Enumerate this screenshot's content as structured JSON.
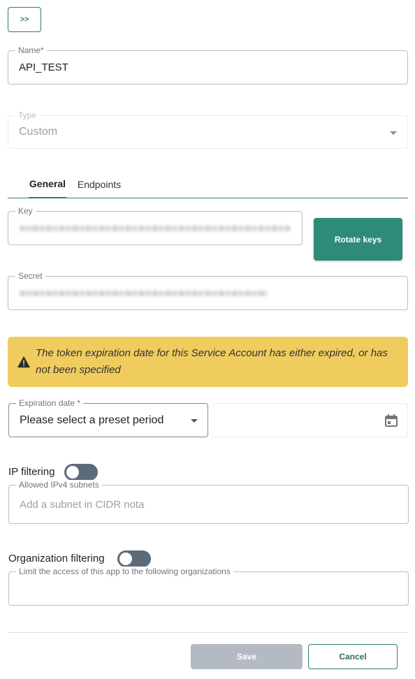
{
  "toolbar": {
    "expand_label": ">>"
  },
  "name": {
    "label": "Name*",
    "value": "API_TEST"
  },
  "type": {
    "label": "Type",
    "value": "Custom"
  },
  "tabs": [
    {
      "label": "General",
      "active": true
    },
    {
      "label": "Endpoints",
      "active": false
    }
  ],
  "key": {
    "label": "Key"
  },
  "rotate": {
    "label": "Rotate keys"
  },
  "secret": {
    "label": "Secret"
  },
  "warning": {
    "icon": "warning-triangle-icon",
    "text": "The token expiration date for this Service Account has either expired, or has not been specified"
  },
  "expiration": {
    "label": "Expiration date *",
    "selected": "Please select a preset period",
    "date_icon": "calendar-icon"
  },
  "ip_filtering": {
    "label": "IP filtering",
    "enabled": false,
    "subnets_label": "Allowed IPv4 subnets",
    "subnets_placeholder": "Add a subnet in CIDR nota"
  },
  "org_filtering": {
    "label": "Organization filtering",
    "enabled": false,
    "orgs_label": "Limit the access of this app to the following organizations"
  },
  "footer": {
    "save_label": "Save",
    "cancel_label": "Cancel"
  },
  "colors": {
    "accent": "#2e8b7a",
    "warning_bg": "#f0cc5f",
    "toggle_off": "#5c6b7a",
    "disabled_button": "#b3bac2"
  }
}
